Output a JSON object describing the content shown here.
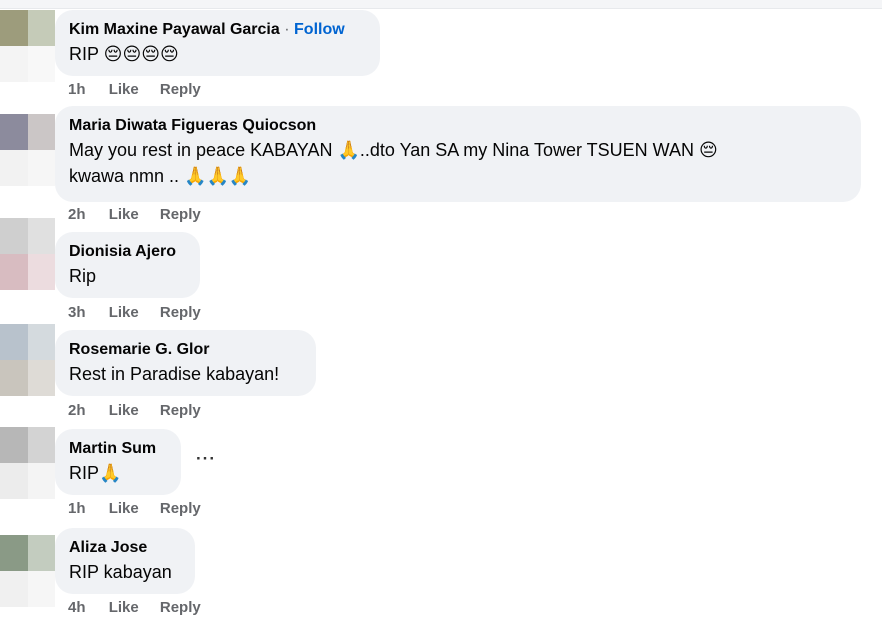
{
  "comments": [
    {
      "author": "Kim Maxine Payawal Garcia",
      "follow_separator": "·",
      "follow_label": "Follow",
      "text": "RIP 😔😔😔😔",
      "time": "1h",
      "like_label": "Like",
      "reply_label": "Reply"
    },
    {
      "author": "Maria Diwata Figueras Quiocson",
      "text_line1": "May you rest in peace KABAYAN 🙏..dto Yan SA my Nina Tower TSUEN WAN 😔",
      "text_line2": "kwawa nmn .. 🙏🙏🙏",
      "time": "2h",
      "like_label": "Like",
      "reply_label": "Reply"
    },
    {
      "author": "Dionisia Ajero",
      "text": "Rip",
      "time": "3h",
      "like_label": "Like",
      "reply_label": "Reply"
    },
    {
      "author": "Rosemarie G. Glor",
      "text": "Rest in Paradise kabayan!",
      "time": "2h",
      "like_label": "Like",
      "reply_label": "Reply"
    },
    {
      "author": "Martin Sum",
      "text": "RIP🙏",
      "more_label": "···",
      "time": "1h",
      "like_label": "Like",
      "reply_label": "Reply"
    },
    {
      "author": "Aliza Jose",
      "text": "RIP kabayan",
      "time": "4h",
      "like_label": "Like",
      "reply_label": "Reply"
    }
  ],
  "colors": {
    "bubble": "#f0f2f5",
    "follow": "#0064d1",
    "meta": "#65676b"
  }
}
